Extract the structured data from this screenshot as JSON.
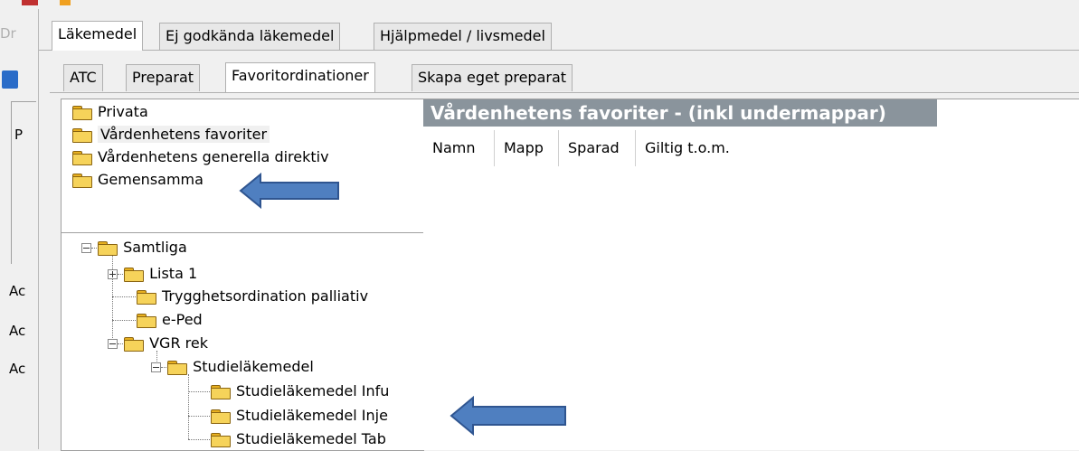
{
  "left_strip": {
    "clipped_text_1": "Dr",
    "clipped_text_2": "P",
    "rows": [
      "Ac",
      "Ac",
      "Ac"
    ]
  },
  "main_tabs": [
    {
      "label": "Läkemedel",
      "active": true
    },
    {
      "label": "Ej godkända läkemedel",
      "active": false
    },
    {
      "label": "Hjälpmedel / livsmedel",
      "active": false
    }
  ],
  "sub_tabs": [
    {
      "label": "ATC",
      "active": false
    },
    {
      "label": "Preparat",
      "active": false
    },
    {
      "label": "Favoritordinationer",
      "active": true
    },
    {
      "label": "Skapa eget preparat",
      "active": false
    }
  ],
  "favorites": {
    "items": [
      {
        "label": "Privata",
        "icon": "folder-icon"
      },
      {
        "label": "Vårdenhetens favoriter",
        "icon": "folder-icon",
        "selected": true
      },
      {
        "label": "Vårdenhetens generella direktiv",
        "icon": "folder-icon"
      },
      {
        "label": "Gemensamma",
        "icon": "folder-icon"
      }
    ]
  },
  "tree": {
    "items": [
      {
        "label": "Samtliga"
      },
      {
        "label": "Lista 1"
      },
      {
        "label": "Trygghetsordination palliativ"
      },
      {
        "label": "e-Ped"
      },
      {
        "label": "VGR rek"
      },
      {
        "label": "Studieläkemedel"
      },
      {
        "label": "Studieläkemedel Infu"
      },
      {
        "label": "Studieläkemedel Inje"
      },
      {
        "label": "Studieläkemedel Tab"
      }
    ]
  },
  "results": {
    "header": "Vårdenhetens favoriter -  (inkl undermappar)",
    "columns": [
      "Namn",
      "Mapp",
      "Sparad",
      "Giltig t.o.m."
    ]
  },
  "colors": {
    "header_bar": "#8a949c",
    "arrow_fill": "#4f7fc0",
    "arrow_stroke": "#2f5590",
    "folder": "#f6d35a"
  }
}
